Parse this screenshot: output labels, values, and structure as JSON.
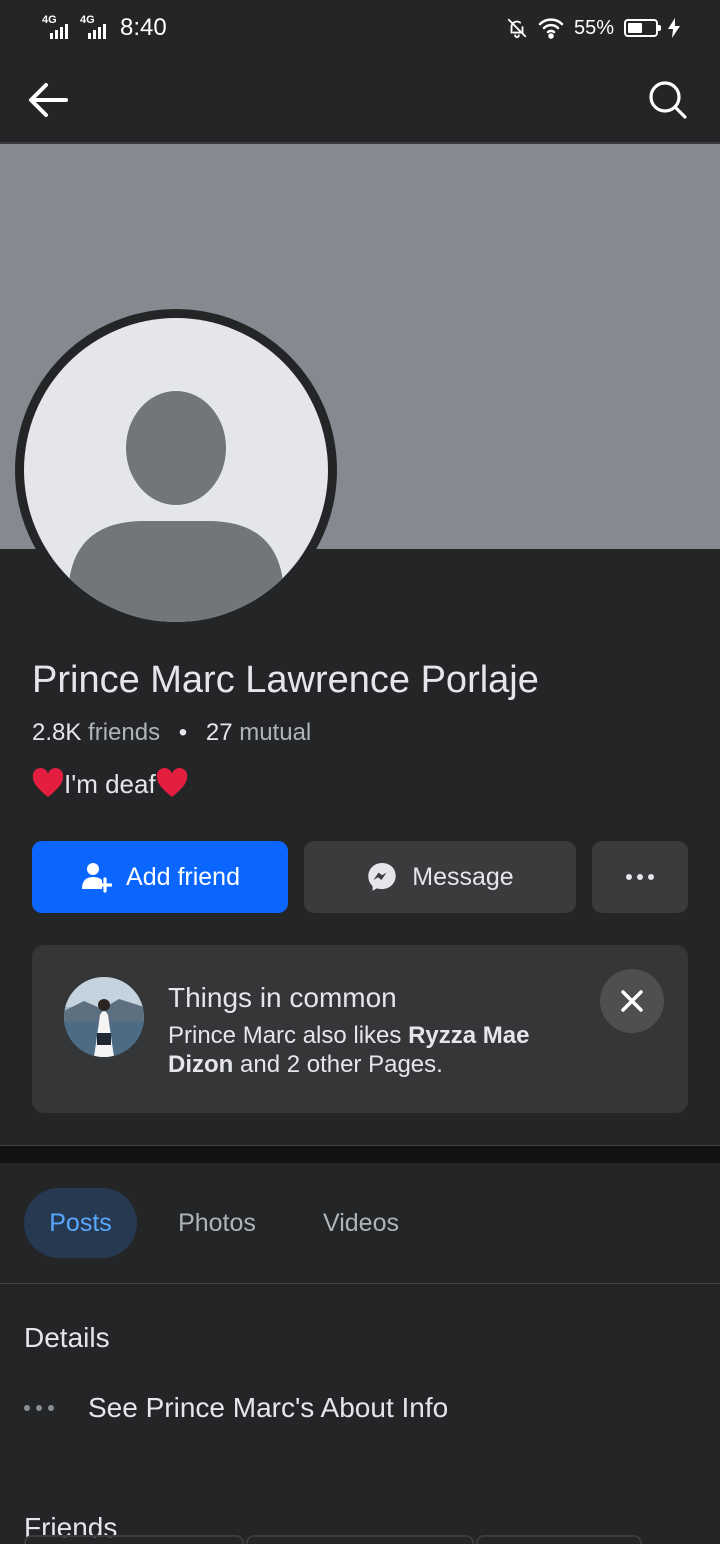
{
  "status_bar": {
    "network1": "4G",
    "network2": "4G",
    "time": "8:40",
    "battery_percent": "55%",
    "battery_level": 0.55,
    "icons": [
      "signal-icon",
      "signal-icon",
      "mute-bell-icon",
      "wifi-icon",
      "battery-icon",
      "charging-bolt-icon"
    ]
  },
  "nav": {
    "back_icon": "arrow-left-icon",
    "search_icon": "search-icon"
  },
  "profile": {
    "name": "Prince Marc Lawrence Porlaje",
    "friends_count": "2.8K",
    "friends_label": "friends",
    "separator": "•",
    "mutual_count": "27",
    "mutual_label": "mutual",
    "bio_text": "I'm deaf"
  },
  "actions": {
    "add_friend": "Add friend",
    "message": "Message",
    "more_icon": "more-horizontal-icon"
  },
  "common": {
    "title": "Things in common",
    "desc_prefix": "Prince Marc also likes ",
    "desc_bold": "Ryzza Mae Dizon",
    "desc_suffix": " and 2 other Pages."
  },
  "tabs": [
    {
      "label": "Posts",
      "active": true
    },
    {
      "label": "Photos",
      "active": false
    },
    {
      "label": "Videos",
      "active": false
    }
  ],
  "details": {
    "title": "Details",
    "about_link": "See Prince Marc's About Info"
  },
  "friends": {
    "title": "Friends"
  },
  "colors": {
    "background": "#242527",
    "cover": "#868990",
    "accent": "#0a66ff",
    "active_tab_bg": "#263951",
    "active_tab_text": "#5aa7ff",
    "heart": "#e41e3f"
  }
}
